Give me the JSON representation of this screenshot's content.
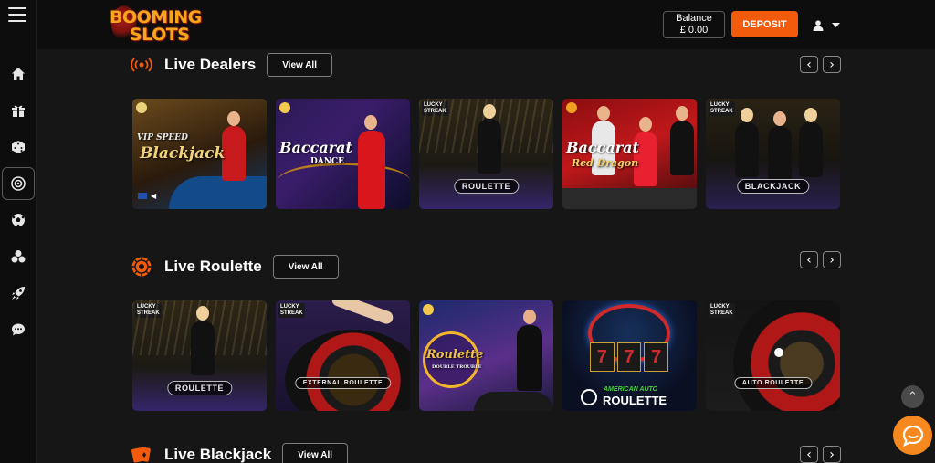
{
  "header": {
    "logo_line1": "BOOMING",
    "logo_line2": "SLOTS",
    "balance_label": "Balance",
    "balance_value": "£ 0.00",
    "deposit_label": "DEPOSIT",
    "accent_color": "#f25a0c"
  },
  "sidebar": {
    "items": [
      {
        "name": "home-icon"
      },
      {
        "name": "gift-icon"
      },
      {
        "name": "dice-icon"
      },
      {
        "name": "roulette-wheel-icon",
        "active": true
      },
      {
        "name": "soccer-ball-icon"
      },
      {
        "name": "poker-chips-icon"
      },
      {
        "name": "rocket-icon"
      },
      {
        "name": "chat-bubble-icon"
      }
    ]
  },
  "sections": [
    {
      "title": "Live Dealers",
      "view_all": "View All",
      "icon": "broadcast-icon",
      "tiles": [
        {
          "game": "VIP Speed Blackjack",
          "script_line1": "VIP SPEED",
          "script_line2": "Blackjack"
        },
        {
          "game": "Baccarat Dance",
          "script_line1": "Baccarat",
          "script_line2": "DANCE"
        },
        {
          "game": "Lucky Streak Roulette",
          "streak": "LUCKY\nSTREAK",
          "banner": "ROULETTE"
        },
        {
          "game": "Baccarat Red Dragon",
          "script_line1": "Baccarat",
          "script_line2": "Red Dragon"
        },
        {
          "game": "Lucky Streak Blackjack",
          "streak": "LUCKY\nSTREAK",
          "banner": "BLACKJACK"
        }
      ]
    },
    {
      "title": "Live Roulette",
      "view_all": "View All",
      "icon": "roulette-icon",
      "tiles": [
        {
          "game": "Lucky Streak Roulette",
          "streak": "LUCKY\nSTREAK",
          "banner": "ROULETTE"
        },
        {
          "game": "External Roulette",
          "streak": "LUCKY\nSTREAK",
          "banner": "EXTERNAL ROULETTE"
        },
        {
          "game": "Roulette Double Trouble",
          "script_line1": "Roulette",
          "script_line2": "DOUBLE TROUBLE"
        },
        {
          "game": "American Auto Roulette",
          "sub": "AMERICAN AUTO",
          "main": "ROULETTE"
        },
        {
          "game": "Auto Roulette",
          "streak": "LUCKY\nSTREAK",
          "banner": "AUTO ROULETTE"
        }
      ]
    },
    {
      "title": "Live Blackjack",
      "view_all": "View All",
      "icon": "cards-icon"
    }
  ],
  "floating": {
    "scroll_top": "⌃"
  }
}
